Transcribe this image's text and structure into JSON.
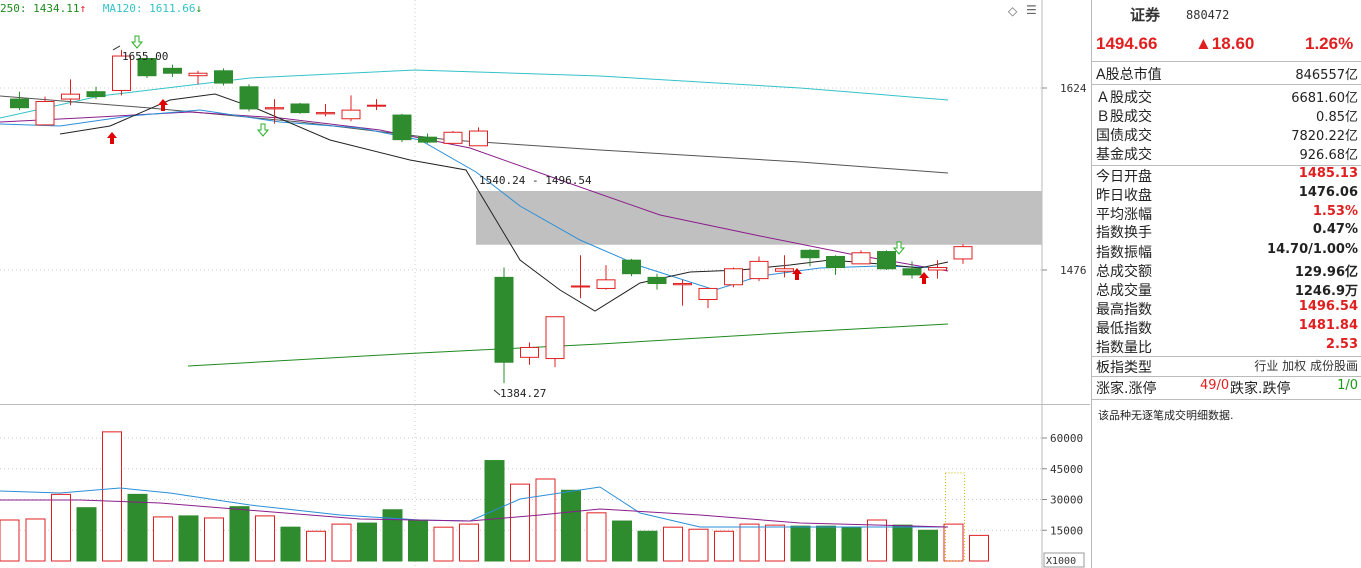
{
  "legend": {
    "ma250": "250: 1434.11",
    "ma250_arrow": "↑",
    "ma120": "MA120: 1611.66",
    "ma120_arrow": "↓"
  },
  "colors": {
    "up": "#e02020",
    "down": "#2e8b2e",
    "ma5": "#222222",
    "ma10": "#2a8fd8",
    "ma20": "#8b1d8b",
    "ma60": "#555555",
    "ma120": "#33c2c8",
    "ma250": "#1e8a1e",
    "gap_box": "#c0c0c0"
  },
  "chart_data": [
    {
      "type": "candlestick",
      "title": "",
      "y_axis_labels": [
        "1624",
        "1476"
      ],
      "annotations": [
        "1655.00",
        "1540.24 - 1496.54",
        "1384.27"
      ],
      "ylim": [
        1370,
        1670
      ],
      "candles": [
        {
          "o": 1615,
          "h": 1621,
          "l": 1606,
          "c": 1608
        },
        {
          "o": 1594,
          "h": 1617,
          "l": 1594,
          "c": 1613
        },
        {
          "o": 1615,
          "h": 1631,
          "l": 1610,
          "c": 1619
        },
        {
          "o": 1621,
          "h": 1625,
          "l": 1615,
          "c": 1617
        },
        {
          "o": 1622,
          "h": 1655,
          "l": 1618,
          "c": 1650
        },
        {
          "o": 1648,
          "h": 1650,
          "l": 1632,
          "c": 1634
        },
        {
          "o": 1640,
          "h": 1643,
          "l": 1633,
          "c": 1636
        },
        {
          "o": 1634,
          "h": 1638,
          "l": 1627,
          "c": 1636
        },
        {
          "o": 1638,
          "h": 1640,
          "l": 1626,
          "c": 1628
        },
        {
          "o": 1625,
          "h": 1627,
          "l": 1605,
          "c": 1607
        },
        {
          "o": 1607,
          "h": 1615,
          "l": 1595,
          "c": 1608
        },
        {
          "o": 1611,
          "h": 1612,
          "l": 1603,
          "c": 1604
        },
        {
          "o": 1603,
          "h": 1611,
          "l": 1601,
          "c": 1604
        },
        {
          "o": 1599,
          "h": 1618,
          "l": 1597,
          "c": 1606
        },
        {
          "o": 1610,
          "h": 1615,
          "l": 1606,
          "c": 1610
        },
        {
          "o": 1602,
          "h": 1603,
          "l": 1580,
          "c": 1582
        },
        {
          "o": 1584,
          "h": 1587,
          "l": 1579,
          "c": 1580
        },
        {
          "o": 1579,
          "h": 1589,
          "l": 1579,
          "c": 1588
        },
        {
          "o": 1577,
          "h": 1592,
          "l": 1577,
          "c": 1589
        },
        {
          "o": 1470,
          "h": 1478,
          "l": 1384,
          "c": 1401
        },
        {
          "o": 1405,
          "h": 1417,
          "l": 1399,
          "c": 1413
        },
        {
          "o": 1404,
          "h": 1435,
          "l": 1397,
          "c": 1438
        },
        {
          "o": 1463,
          "h": 1488,
          "l": 1453,
          "c": 1463
        },
        {
          "o": 1461,
          "h": 1480,
          "l": 1460,
          "c": 1468
        },
        {
          "o": 1484,
          "h": 1485,
          "l": 1471,
          "c": 1473
        },
        {
          "o": 1470,
          "h": 1473,
          "l": 1460,
          "c": 1465
        },
        {
          "o": 1464,
          "h": 1468,
          "l": 1447,
          "c": 1465
        },
        {
          "o": 1452,
          "h": 1460,
          "l": 1445,
          "c": 1461
        },
        {
          "o": 1464,
          "h": 1478,
          "l": 1462,
          "c": 1477
        },
        {
          "o": 1469,
          "h": 1487,
          "l": 1467,
          "c": 1483
        },
        {
          "o": 1475,
          "h": 1488,
          "l": 1470,
          "c": 1477
        },
        {
          "o": 1492,
          "h": 1493,
          "l": 1479,
          "c": 1486
        },
        {
          "o": 1487,
          "h": 1488,
          "l": 1472,
          "c": 1478
        },
        {
          "o": 1481,
          "h": 1492,
          "l": 1481,
          "c": 1490
        },
        {
          "o": 1491,
          "h": 1492,
          "l": 1476,
          "c": 1477
        },
        {
          "o": 1477,
          "h": 1483,
          "l": 1469,
          "c": 1472
        },
        {
          "o": 1476,
          "h": 1484,
          "l": 1469,
          "c": 1478
        },
        {
          "o": 1485,
          "h": 1497,
          "l": 1481,
          "c": 1495
        }
      ]
    },
    {
      "type": "bar",
      "title": "",
      "y_axis_labels": [
        "60000",
        "45000",
        "30000",
        "15000"
      ],
      "unit_label": "X1000",
      "ylim": [
        0,
        65000
      ],
      "values": [
        20000,
        20500,
        32500,
        26000,
        63000,
        32500,
        21500,
        22000,
        21000,
        26500,
        22000,
        16500,
        14500,
        18000,
        18500,
        25000,
        20000,
        16500,
        18000,
        49000,
        37500,
        40000,
        34500,
        23500,
        19500,
        14500,
        16500,
        15500,
        14500,
        18000,
        17500,
        17000,
        17000,
        16500,
        20000,
        17500,
        15000,
        18000,
        12500
      ],
      "up": [
        true,
        true,
        true,
        false,
        true,
        false,
        true,
        false,
        true,
        false,
        true,
        false,
        true,
        true,
        false,
        false,
        false,
        true,
        true,
        false,
        true,
        true,
        false,
        true,
        false,
        false,
        true,
        true,
        true,
        true,
        true,
        false,
        false,
        false,
        true,
        false,
        false,
        true,
        true
      ]
    }
  ],
  "panel": {
    "title": "证券",
    "code": "880472",
    "price": "1494.66",
    "change": "▲18.60",
    "pct": "1.26%",
    "rows": [
      {
        "label": "A股总市值",
        "value": "846557亿",
        "cls": ""
      },
      {
        "label": "Ａ股成交",
        "value": "6681.60亿",
        "cls": ""
      },
      {
        "label": "Ｂ股成交",
        "value": "0.85亿",
        "cls": ""
      },
      {
        "label": "国债成交",
        "value": "7820.22亿",
        "cls": ""
      },
      {
        "label": "基金成交",
        "value": "926.68亿",
        "cls": ""
      },
      {
        "label": "今日开盘",
        "value": "1485.13",
        "cls": "red"
      },
      {
        "label": "昨日收盘",
        "value": "1476.06",
        "cls": ""
      },
      {
        "label": "平均涨幅",
        "value": "1.53%",
        "cls": "red"
      },
      {
        "label": "指数换手",
        "value": "0.47%",
        "cls": ""
      },
      {
        "label": "指数振幅",
        "value": "14.70/1.00%",
        "cls": ""
      },
      {
        "label": "总成交额",
        "value": "129.96亿",
        "cls": ""
      },
      {
        "label": "总成交量",
        "value": "1246.9万",
        "cls": ""
      },
      {
        "label": "最高指数",
        "value": "1496.54",
        "cls": "red"
      },
      {
        "label": "最低指数",
        "value": "1481.84",
        "cls": "red"
      },
      {
        "label": "指数量比",
        "value": "2.53",
        "cls": "red"
      },
      {
        "label": "板指类型",
        "value": "行业 加权 成份股画",
        "cls": ""
      }
    ],
    "updown": {
      "up_label": "涨家.涨停",
      "up_val": "49/0",
      "down_label": "跌家.跌停",
      "down_val": "1/0"
    },
    "note": "该品种无逐笔成交明细数据."
  }
}
